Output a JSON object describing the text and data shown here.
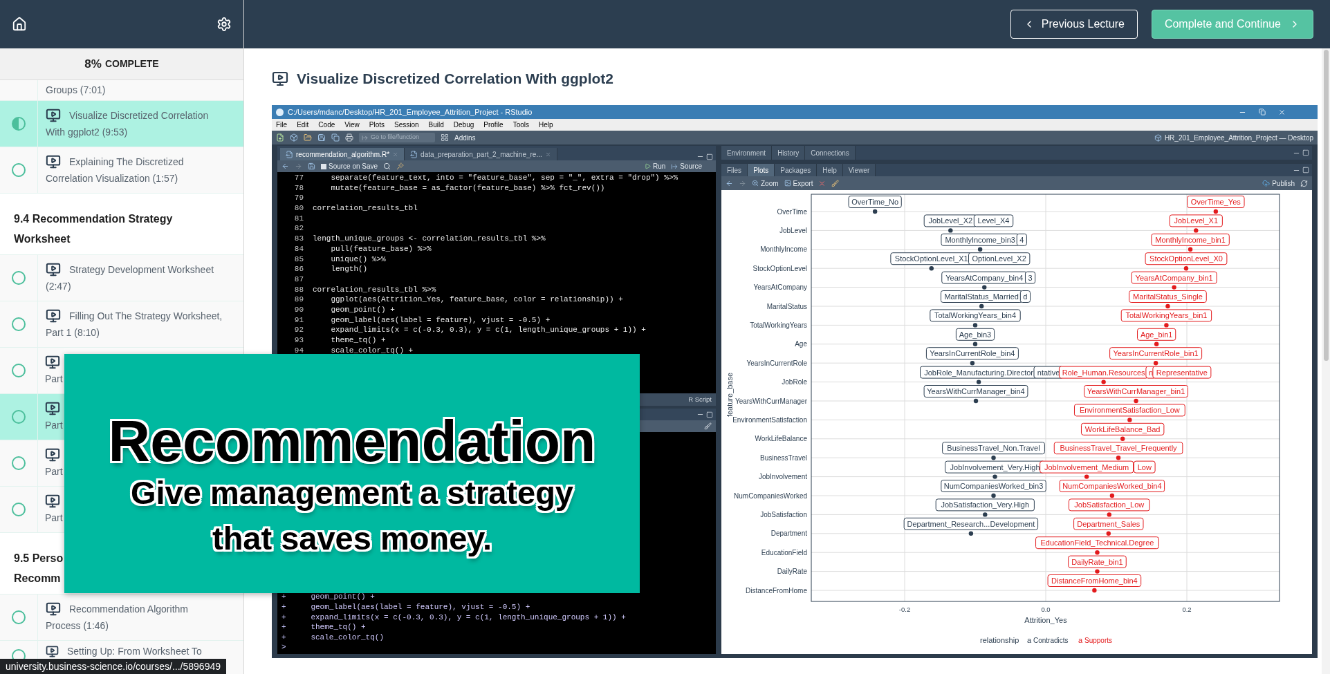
{
  "sidebar": {
    "progress": {
      "percent": "8%",
      "label": "COMPLETE"
    },
    "items": [
      {
        "kind": "tail",
        "lines": [
          "Groups (7:01)"
        ],
        "selected": false
      },
      {
        "kind": "lecture",
        "lines": [
          "Visualize Discretized Correlation",
          "With ggplot2 (9:53)"
        ],
        "in_progress": true,
        "selected": true
      },
      {
        "kind": "lecture",
        "lines": [
          "Explaining The Discretized",
          "Correlation Visualization (1:57)"
        ],
        "in_progress": false,
        "selected": false
      },
      {
        "kind": "section",
        "lines": [
          "9.4 Recommendation Strategy",
          "Worksheet"
        ]
      },
      {
        "kind": "lecture",
        "lines": [
          "Strategy Development Worksheet",
          "(2:47)"
        ],
        "in_progress": false,
        "selected": false
      },
      {
        "kind": "lecture",
        "lines": [
          "Filling Out The Strategy Worksheet,",
          "Part 1 (8:10)"
        ],
        "in_progress": false,
        "selected": false
      },
      {
        "kind": "covered",
        "lines": [
          "Part"
        ],
        "in_progress": false,
        "selected": false
      },
      {
        "kind": "covered",
        "lines": [
          "Part"
        ],
        "in_progress": false,
        "selected": true
      },
      {
        "kind": "covered",
        "lines": [
          "Part"
        ],
        "in_progress": false,
        "selected": false
      },
      {
        "kind": "covered",
        "lines": [
          "Part"
        ],
        "in_progress": false,
        "selected": false
      },
      {
        "kind": "section",
        "lines": [
          "9.5 Perso",
          "Recomm"
        ]
      },
      {
        "kind": "lecture",
        "lines": [
          "Recommendation Algorithm",
          "Process (1:46)"
        ],
        "in_progress": false,
        "selected": false
      },
      {
        "kind": "lecture",
        "lines": [
          "Setting Up: From Worksheet To"
        ],
        "in_progress": false,
        "selected": false
      }
    ]
  },
  "top_bar": {
    "buttons": [
      {
        "label": "Previous Lecture",
        "kind": "outline"
      },
      {
        "label": "Complete and Continue",
        "kind": "primary"
      }
    ]
  },
  "lecture": {
    "title": "Visualize Discretized Correlation With ggplot2"
  },
  "rstudio": {
    "window_title": "C:/Users/mdanc/Desktop/HR_201_Employee_Attrition_Project - RStudio",
    "menu": [
      "File",
      "Edit",
      "Code",
      "View",
      "Plots",
      "Session",
      "Build",
      "Debug",
      "Profile",
      "Tools",
      "Help"
    ],
    "goto_placeholder": "Go to file/function",
    "addins": "Addins",
    "project": "HR_201_Employee_Attrition_Project — Desktop",
    "editor": {
      "tabs": [
        {
          "label": "recommendation_algorithm.R*",
          "selected": true
        },
        {
          "label": "data_preparation_part_2_machine_re...",
          "selected": false
        }
      ],
      "source_on_save": {
        "label": "Source on Save",
        "checked": false
      },
      "run": "Run",
      "source": "Source",
      "file_type": "R Script",
      "lines": [
        {
          "number": "77",
          "code": "    separate(feature_text, into = \"feature_base\", sep = \"_\", extra = \"drop\") %>%"
        },
        {
          "number": "78",
          "code": "    mutate(feature_base = as_factor(feature_base) %>% fct_rev())"
        },
        {
          "number": "79"
        },
        {
          "number": "80",
          "code": "correlation_results_tbl"
        },
        {
          "number": "81"
        },
        {
          "number": "82"
        },
        {
          "number": "83",
          "code": "length_unique_groups <- correlation_results_tbl %>%"
        },
        {
          "number": "84",
          "code": "    pull(feature_base) %>%"
        },
        {
          "number": "85",
          "code": "    unique() %>%"
        },
        {
          "number": "86",
          "code": "    length()"
        },
        {
          "number": "87"
        },
        {
          "number": "88",
          "code": "correlation_results_tbl %>%"
        },
        {
          "number": "89",
          "code": "    ggplot(aes(Attrition_Yes, feature_base, color = relationship)) +"
        },
        {
          "number": "90",
          "code": "    geom_point() +"
        },
        {
          "number": "91",
          "code": "    geom_label(aes(label = feature), vjust = -0.5) +"
        },
        {
          "number": "92",
          "code": "    expand_limits(x = c(-0.3, 0.3), y = c(1, length_unique_groups + 1)) +"
        },
        {
          "number": "93",
          "code": "    theme_tq() +"
        },
        {
          "number": "94",
          "code": "    scale_color_tq() +"
        }
      ]
    },
    "console": {
      "lines": [
        {
          "prefix": "+",
          "code": "    geom_point() +"
        },
        {
          "prefix": "+",
          "code": "    geom_label(aes(label = feature), vjust = -0.5) +"
        },
        {
          "prefix": "+",
          "code": "    expand_limits(x = c(-0.3, 0.3), y = c(1, length_unique_groups + 1)) +"
        },
        {
          "prefix": "+",
          "code": "    theme_tq() +"
        },
        {
          "prefix": "+",
          "code": "    scale_color_tq()"
        }
      ],
      "prompt": ">"
    },
    "env_tabs": [
      {
        "label": "Environment",
        "selected": false
      },
      {
        "label": "History",
        "selected": false
      },
      {
        "label": "Connections",
        "selected": false
      }
    ],
    "files_tabs": [
      {
        "label": "Files",
        "selected": false
      },
      {
        "label": "Plots",
        "selected": true
      },
      {
        "label": "Packages",
        "selected": false
      },
      {
        "label": "Help",
        "selected": false
      },
      {
        "label": "Viewer",
        "selected": false
      }
    ],
    "plot_toolbar": {
      "zoom": "Zoom",
      "export": "Export",
      "publish": "Publish"
    },
    "plot_legend": {
      "title": "relationship",
      "keys": [
        "a",
        "a"
      ]
    },
    "chart_data": {
      "type": "scatter",
      "orientation": "horizontal",
      "grid": true,
      "xlabel": "Attrition_Yes",
      "ylabel": "feature_base",
      "xlim": [
        -0.33,
        0.33
      ],
      "xticks": [
        {
          "value": -0.2,
          "label": "-0.2"
        },
        {
          "value": 0,
          "label": "0.0"
        },
        {
          "value": 0.2,
          "label": "0.2"
        }
      ],
      "categories": [
        "OverTime",
        "JobLevel",
        "MonthlyIncome",
        "StockOptionLevel",
        "YearsAtCompany",
        "MaritalStatus",
        "TotalWorkingYears",
        "Age",
        "YearsInCurrentRole",
        "JobRole",
        "YearsWithCurrManager",
        "EnvironmentSatisfaction",
        "WorkLifeBalance",
        "BusinessTravel",
        "JobInvolvement",
        "NumCompaniesWorked",
        "JobSatisfaction",
        "Department",
        "EducationField",
        "DailyRate",
        "DistanceFromHome"
      ],
      "series": [
        {
          "name": "Contradicts",
          "color": "#2c3e50",
          "values": [
            -0.242,
            -0.135,
            -0.093,
            -0.162,
            -0.087,
            -0.091,
            -0.1,
            -0.1,
            -0.104,
            -0.095,
            -0.099,
            null,
            null,
            -0.074,
            -0.072,
            -0.074,
            -0.086,
            -0.106,
            null,
            null,
            null
          ]
        },
        {
          "name": "Supports",
          "color": "#e31a1c",
          "values": [
            0.241,
            0.213,
            0.205,
            0.199,
            0.182,
            0.173,
            0.171,
            0.157,
            0.156,
            0.082,
            0.128,
            0.119,
            0.109,
            0.103,
            0.058,
            0.094,
            0.09,
            0.089,
            0.073,
            0.073,
            0.069
          ]
        }
      ],
      "annotations": [
        "OverTime_No",
        "JobLevel_X2",
        "Level_X4",
        "MonthlyIncome_bin3",
        "4",
        "StockOptionLevel_X1",
        "OptionLevel_X2",
        "YearsAtCompany_bin4",
        "3",
        "MaritalStatus_Married",
        "d",
        "TotalWorkingYears_bin4",
        "Age_bin3",
        "YearsInCurrentRole_bin4",
        "JobRole_Manufacturing.Director",
        "ntative",
        "YearsWithCurrManager_bin4",
        "BusinessTravel_Non.Travel",
        "JobInvolvement_Very.High",
        "NumCompaniesWorked_bin3",
        "JobSatisfaction_Very.High",
        "Department_Research...Development",
        "OverTime_Yes",
        "JobLevel_X1",
        "MonthlyIncome_bin1",
        "StockOptionLevel_X0",
        "YearsAtCompany_bin1",
        "MaritalStatus_Single",
        "TotalWorkingYears_bin1",
        "Age_bin1",
        "YearsInCurrentRole_bin1",
        "Role_Human.Resources",
        "n",
        "Representative",
        "YearsWithCurrManager_bin1",
        "EnvironmentSatisfaction_Low",
        "WorkLifeBalance_Bad",
        "BusinessTravel_Travel_Frequently",
        "JobInvolvement_Medium",
        "Low",
        "NumCompaniesWorked_bin4",
        "JobSatisfaction_Low",
        "Department_Sales",
        "EducationField_Technical.Degree",
        "DailyRate_bin1",
        "DistanceFromHome_bin4"
      ]
    }
  },
  "overlay": {
    "title": "Recommendation",
    "lines": [
      "Give management a strategy",
      "that saves money."
    ]
  },
  "status_url": "university.business-science.io/courses/.../5896949"
}
